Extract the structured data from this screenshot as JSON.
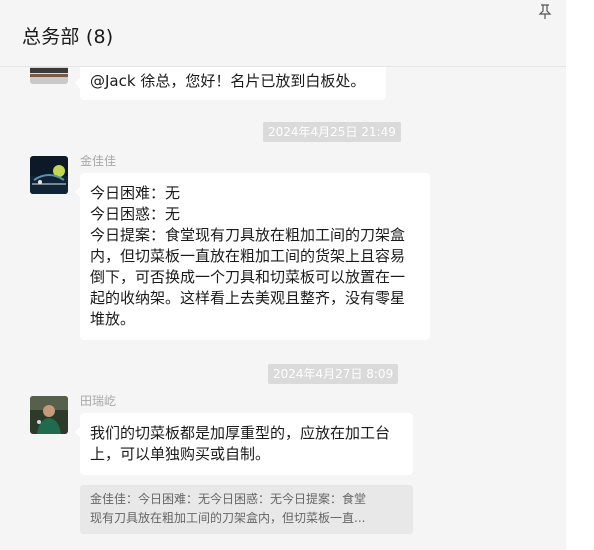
{
  "header": {
    "title": "总务部 (8)",
    "pin_icon": "pin-icon"
  },
  "messages": [
    {
      "sender": "",
      "lines": [
        "@Jack 徐总，您好！名片已放到白板处。"
      ]
    },
    {
      "timestamp": "2024年4月25日 21:49",
      "sender": "金佳佳",
      "lines": [
        "今日困难：无",
        "今日困惑：无",
        "今日提案：食堂现有刀具放在粗加工间的刀架盒",
        "内，但切菜板一直放在粗加工间的货架上且容易",
        "倒下，可否换成一个刀具和切菜板可以放置在一",
        "起的收纳架。这样看上去美观且整齐，没有零星",
        "堆放。"
      ]
    },
    {
      "timestamp": "2024年4月27日 8:09",
      "sender": "田瑞屹",
      "lines": [
        "我们的切菜板都是加厚重型的，应放在加工台",
        "上，可以单独购买或自制。"
      ],
      "quote": [
        "金佳佳：今日困难：无今日困惑：无今日提案：食堂",
        "现有刀具放在粗加工间的刀架盒内，但切菜板一直..."
      ]
    }
  ],
  "colors": {
    "chat_background": "#f5f5f5",
    "bubble": "#ffffff",
    "timestamp_bg": "#dadada",
    "quote_bg": "#e8e8e8"
  }
}
